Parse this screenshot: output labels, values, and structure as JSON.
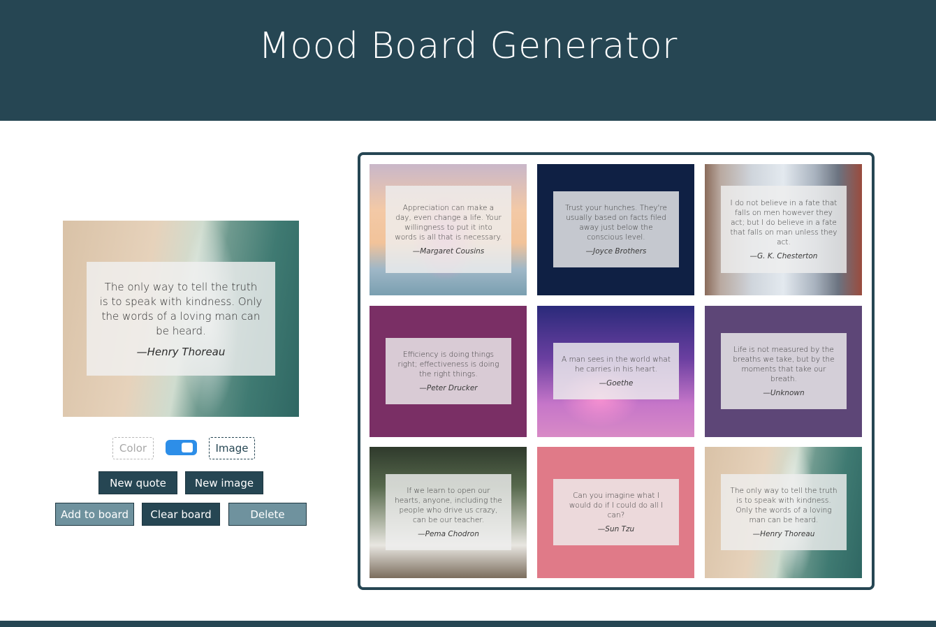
{
  "header": {
    "title": "Mood Board Generator"
  },
  "preview": {
    "quote": "The only way to tell the truth is to speak with kindness. Only the words of a loving man can be heard.",
    "author": "—Henry Thoreau"
  },
  "toggle": {
    "color_label": "Color",
    "image_label": "Image",
    "selected": "Image"
  },
  "buttons": {
    "new_quote": "New quote",
    "new_image": "New image",
    "add_to_board": "Add to board",
    "clear_board": "Clear board",
    "delete": "Delete"
  },
  "board": {
    "tiles": [
      {
        "quote": "Appreciation can make a day, even change a life. Your willingness to put it into words is all that is necessary.",
        "author": "—Margaret Cousins",
        "background": "sunset-tree-image"
      },
      {
        "quote": "Trust your hunches. They're usually based on facts filed away just below the conscious level.",
        "author": "—Joyce Brothers",
        "background": "#0f2044"
      },
      {
        "quote": "I do not believe in a fate that falls on men however they act; but I do believe in a fate that falls on man unless they act.",
        "author": "—G. K. Chesterton",
        "background": "city-street-image"
      },
      {
        "quote": "Efficiency is doing things right; effectiveness is doing the right things.",
        "author": "—Peter Drucker",
        "background": "#7a2f65"
      },
      {
        "quote": "A man sees in the world what he carries in his heart.",
        "author": "—Goethe",
        "background": "galaxy-tree-image"
      },
      {
        "quote": "Life is not measured by the breaths we take, but by the moments that take our breath.",
        "author": "—Unknown",
        "background": "#5d4677"
      },
      {
        "quote": "If we learn to open our hearts, anyone, including the people who drive us crazy, can be our teacher.",
        "author": "—Pema Chodron",
        "background": "van-forest-image"
      },
      {
        "quote": "Can you imagine what I would do if I could do all I can?",
        "author": "—Sun Tzu",
        "background": "#e07a88"
      },
      {
        "quote": "The only way to tell the truth is to speak with kindness. Only the words of a loving man can be heard.",
        "author": "—Henry Thoreau",
        "background": "beach-aerial-image"
      }
    ]
  }
}
